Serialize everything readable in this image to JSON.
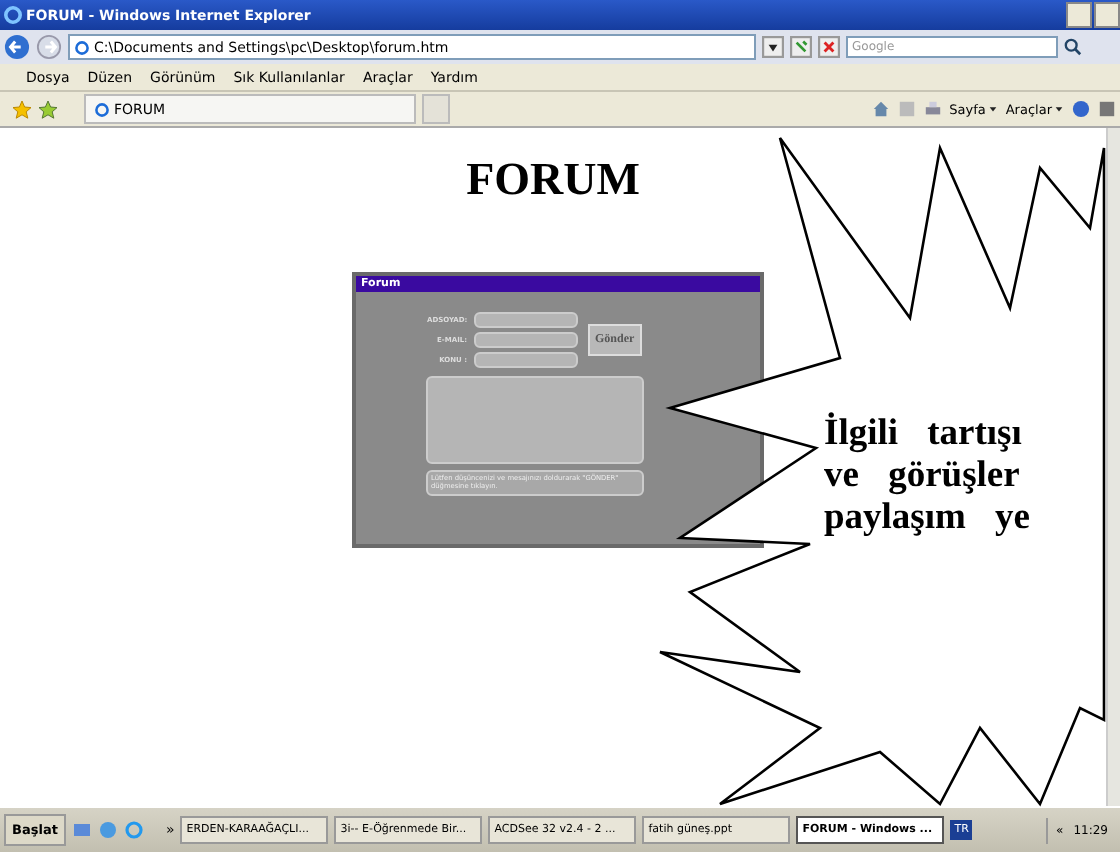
{
  "window": {
    "title": "FORUM - Windows Internet Explorer"
  },
  "address_bar": {
    "value": "C:\\Documents and Settings\\pc\\Desktop\\forum.htm"
  },
  "search": {
    "placeholder": "Google"
  },
  "menu": [
    "Dosya",
    "Düzen",
    "Görünüm",
    "Sık Kullanılanlar",
    "Araçlar",
    "Yardım"
  ],
  "tab": {
    "label": "FORUM"
  },
  "command_bar": [
    "Sayfa",
    "Araçlar"
  ],
  "page": {
    "heading": "FORUM",
    "form": {
      "title": "Forum",
      "fields": [
        "ADSOYAD:",
        "E-MAIL:",
        "KONU :"
      ],
      "button": "Gönder",
      "note": "Lütfen düşüncenizi ve mesajınızı doldurarak \"GÖNDER\" düğmesine tıklayın."
    }
  },
  "callout": {
    "lines": [
      "İlgili tartışı",
      "ve görüşler",
      "paylaşım ye"
    ]
  },
  "taskbar": {
    "start": "Başlat",
    "more": "»",
    "tasks": [
      {
        "label": "ERDEN-KARAAĞAÇLI...",
        "selected": false
      },
      {
        "label": "3i-- E-Öğrenmede Bir...",
        "selected": false
      },
      {
        "label": "ACDSee 32 v2.4 - 2 ...",
        "selected": false
      },
      {
        "label": "fatih güneş.ppt",
        "selected": false
      },
      {
        "label": "FORUM - Windows ...",
        "selected": true
      }
    ],
    "language": "TR",
    "tray_toggle": "«",
    "clock": "11:29"
  }
}
